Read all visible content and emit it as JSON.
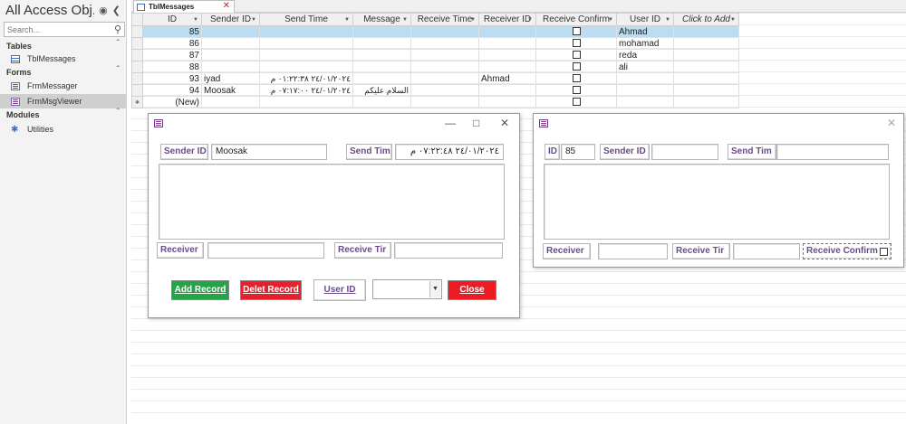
{
  "nav": {
    "title": "All Access Obj...",
    "search_placeholder": "Search...",
    "groups": [
      {
        "label": "Tables",
        "items": [
          "TblMessages"
        ]
      },
      {
        "label": "Forms",
        "items": [
          "FrmMessager",
          "FrmMsgViewer"
        ]
      },
      {
        "label": "Modules",
        "items": [
          "Utilities"
        ]
      }
    ],
    "selected_item": "FrmMsgViewer"
  },
  "tab": {
    "label": "TblMessages"
  },
  "datasheet": {
    "columns": [
      "ID",
      "Sender ID",
      "Send Time",
      "Message",
      "Receive Time",
      "Receiver ID",
      "Receive Confirm",
      "User ID",
      "Click to Add"
    ],
    "rows": [
      {
        "id": "85",
        "sender": "",
        "send_time": "",
        "message": "",
        "receive_time": "",
        "receiver": "",
        "confirm": false,
        "user": "Ahmad"
      },
      {
        "id": "86",
        "sender": "",
        "send_time": "",
        "message": "",
        "receive_time": "",
        "receiver": "",
        "confirm": false,
        "user": "mohamad"
      },
      {
        "id": "87",
        "sender": "",
        "send_time": "",
        "message": "",
        "receive_time": "",
        "receiver": "",
        "confirm": false,
        "user": "reda"
      },
      {
        "id": "88",
        "sender": "",
        "send_time": "",
        "message": "",
        "receive_time": "",
        "receiver": "",
        "confirm": false,
        "user": "ali"
      },
      {
        "id": "93",
        "sender": "iyad",
        "send_time": "٢٤/٠١/٢٠٢٤ ٠١:٢٢:٣٨ م",
        "message": "",
        "receive_time": "",
        "receiver": "Ahmad",
        "confirm": false,
        "user": ""
      },
      {
        "id": "94",
        "sender": "Moosak",
        "send_time": "٢٤/٠١/٢٠٢٤ ٠٧:١٧:٠٠ م",
        "message": "السلام عليكم",
        "receive_time": "",
        "receiver": "",
        "confirm": false,
        "user": ""
      }
    ],
    "new_row_label": "(New)"
  },
  "form_messager": {
    "sender_label": "Sender ID",
    "sender_value": "Moosak",
    "send_time_label": "Send Tim",
    "send_time_value": "٢٤/٠١/٢٠٢٤ ٠٧:٢٢:٤٨ م",
    "receiver_label": "Receiver",
    "receiver_value": "",
    "receive_time_label": "Receive Tir",
    "receive_time_value": "",
    "add_button": "Add Record",
    "delete_button": "Delet Record",
    "user_id_label": "User ID",
    "user_id_value": "",
    "close_button": "Close",
    "colors": {
      "add": "#22a447",
      "delete": "#e8202c",
      "close": "#ec1c24"
    }
  },
  "form_viewer": {
    "id_label": "ID",
    "id_value": "85",
    "sender_label": "Sender ID",
    "sender_value": "",
    "send_time_label": "Send Tim",
    "send_time_value": "",
    "receiver_label": "Receiver",
    "receiver_value": "",
    "receive_time_label": "Receive Tir",
    "receive_time_value": "",
    "confirm_label": "Receive Confirm"
  }
}
